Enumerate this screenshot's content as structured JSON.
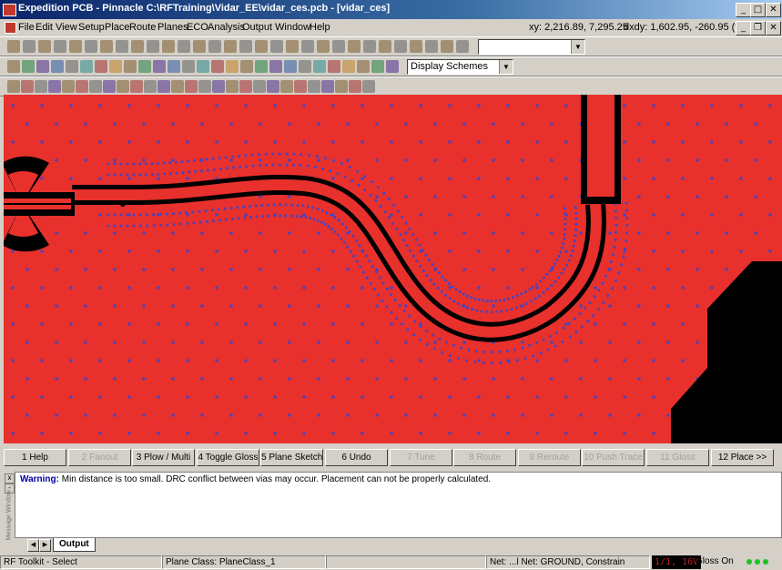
{
  "window": {
    "title": "Expedition PCB - Pinnacle  C:\\RFTraining\\Vidar_EE\\vidar_ces.pcb - [vidar_ces]",
    "coords_xy": "xy: 2,216.89, 7,295.25",
    "coords_dxdy": "dxdy: 1,602.95, -260.95  (th)"
  },
  "menu": {
    "items": [
      "File",
      "Edit",
      "View",
      "Setup",
      "Place",
      "Route",
      "Planes",
      "ECO",
      "Analysis",
      "Output",
      "Window",
      "Help"
    ]
  },
  "toolbar": {
    "combo1_value": "",
    "display_schemes": "Display Schemes"
  },
  "colors": {
    "plane": "#e8302d",
    "trace": "#000000",
    "via": "#3c46c8"
  },
  "function_keys": [
    {
      "label": "1 Help",
      "enabled": true
    },
    {
      "label": "2 Fanout",
      "enabled": false
    },
    {
      "label": "3 Plow / Multi",
      "enabled": true
    },
    {
      "label": "4 Toggle Gloss",
      "enabled": true
    },
    {
      "label": "5 Plane Sketch",
      "enabled": true
    },
    {
      "label": "6 Undo",
      "enabled": true
    },
    {
      "label": "7 Tune",
      "enabled": false
    },
    {
      "label": "8 Route",
      "enabled": false
    },
    {
      "label": "9 Reroute",
      "enabled": false
    },
    {
      "label": "10 Push Trace",
      "enabled": false
    },
    {
      "label": "11 Gloss",
      "enabled": false
    },
    {
      "label": "12 Place >>",
      "enabled": true
    }
  ],
  "output": {
    "warning_label": "Warning:",
    "warning_text": "Min distance is too small. DRC conflict between vias may occur. Placement can not be properly calculated.",
    "side_label": "Message Window",
    "tab": "Output"
  },
  "status": {
    "mode": "RF Toolkit - Select",
    "plane_class": "Plane Class: PlaneClass_1",
    "net": "Net: ...l Net: GROUND, Constrain",
    "layer": "1/1, 16V",
    "gloss": "Gloss On"
  }
}
